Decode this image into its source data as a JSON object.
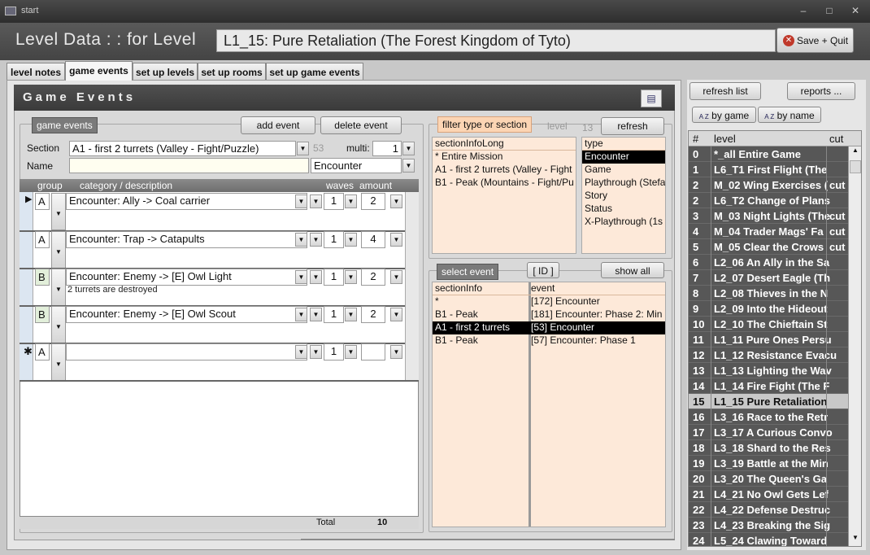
{
  "window": {
    "title": "start",
    "min": "–",
    "max": "□",
    "close": "✕"
  },
  "header": {
    "title": "Level Data : : for Level",
    "level_value": "L1_15: Pure Retaliation (The Forest Kingdom of Tyto)",
    "save_quit": "Save + Quit"
  },
  "tabs": [
    "level notes",
    "game events",
    "set up levels",
    "set up rooms",
    "set up game events"
  ],
  "panel": {
    "title": "Game Events"
  },
  "events_group": {
    "label": "game events",
    "add_event": "add event",
    "delete_event": "delete event",
    "section_label": "Section",
    "section_value": "A1 - first 2 turrets (Valley - Fight/Puzzle)",
    "section_num": "53",
    "multi_label": "multi:",
    "multi_value": "1",
    "name_label": "Name",
    "name_value": "",
    "type_value": "Encounter",
    "grid": {
      "col_group": "group",
      "col_category": "category / description",
      "col_waves": "waves",
      "col_amount": "amount",
      "rows": [
        {
          "group": "A",
          "category": "Encounter: Ally -> Coal carrier",
          "waves": "1",
          "amount": "2",
          "desc": ""
        },
        {
          "group": "A",
          "category": "Encounter: Trap -> Catapults",
          "waves": "1",
          "amount": "4",
          "desc": ""
        },
        {
          "group": "B",
          "category": "Encounter: Enemy -> [E] Owl Light",
          "waves": "1",
          "amount": "2",
          "desc": "2 turrets are destroyed"
        },
        {
          "group": "B",
          "category": "Encounter: Enemy -> [E] Owl Scout",
          "waves": "1",
          "amount": "2",
          "desc": ""
        },
        {
          "group": "A",
          "category": "",
          "waves": "1",
          "amount": "",
          "desc": ""
        }
      ],
      "new_row_marker": "✱",
      "current_row_marker": "▶",
      "total_label": "Total",
      "total_value": "10"
    }
  },
  "filter": {
    "label": "filter type or section",
    "level_label": "level",
    "level_value": "13",
    "refresh": "refresh",
    "section_header": "sectionInfoLong",
    "sections": [
      "* Entire Mission",
      "A1 - first 2 turrets (Valley - Fight",
      "B1 - Peak (Mountains - Fight/Pu"
    ],
    "type_header": "type",
    "types": [
      "Encounter",
      "Game",
      "Playthrough (Stefa",
      "Story",
      "Status",
      "X-Playthrough (1s"
    ]
  },
  "select_event": {
    "label": "select event",
    "id_button": "[ ID ]",
    "show_all": "show all",
    "col_section": "sectionInfo",
    "col_event": "event",
    "rows": [
      {
        "section": "*",
        "event": "[172] Encounter"
      },
      {
        "section": "B1 - Peak",
        "event": "[181] Encounter: Phase 2: Min"
      },
      {
        "section": "A1 - first 2 turrets",
        "event": "[53] Encounter"
      },
      {
        "section": "B1 - Peak",
        "event": "[57] Encounter: Phase 1"
      }
    ]
  },
  "right": {
    "refresh_list": "refresh list",
    "reports": "reports ...",
    "by_game": "by game",
    "by_name": "by name",
    "sort_icon_text": "A Z",
    "col_num": "#",
    "col_level": "level",
    "col_cut": "cut",
    "levels": [
      {
        "n": "0",
        "level": "*_all Entire Game",
        "cut": ""
      },
      {
        "n": "1",
        "level": "L6_T1 First Flight (The",
        "cut": ""
      },
      {
        "n": "2",
        "level": "M_02 Wing Exercises (",
        "cut": "cut"
      },
      {
        "n": "2",
        "level": "L6_T2 Change of Plans",
        "cut": ""
      },
      {
        "n": "3",
        "level": "M_03 Night Lights (The",
        "cut": "cut"
      },
      {
        "n": "4",
        "level": "M_04 Trader Mags' Fa",
        "cut": "cut"
      },
      {
        "n": "5",
        "level": "M_05 Clear the Crows",
        "cut": "cut"
      },
      {
        "n": "6",
        "level": "L2_06 An Ally in the Sa",
        "cut": ""
      },
      {
        "n": "7",
        "level": "L2_07 Desert Eagle (Th",
        "cut": ""
      },
      {
        "n": "8",
        "level": "L2_08 Thieves in the N",
        "cut": ""
      },
      {
        "n": "9",
        "level": "L2_09 Into the Hideout",
        "cut": ""
      },
      {
        "n": "10",
        "level": "L2_10 The Chieftain St",
        "cut": ""
      },
      {
        "n": "11",
        "level": "L1_11 Pure Ones Persu",
        "cut": ""
      },
      {
        "n": "12",
        "level": "L1_12 Resistance Evacu",
        "cut": ""
      },
      {
        "n": "13",
        "level": "L1_13 Lighting the Wav",
        "cut": ""
      },
      {
        "n": "14",
        "level": "L1_14 Fire Fight (The F",
        "cut": ""
      },
      {
        "n": "15",
        "level": "L1_15 Pure Retaliation",
        "cut": ""
      },
      {
        "n": "16",
        "level": "L3_16 Race to the Retr",
        "cut": ""
      },
      {
        "n": "17",
        "level": "L3_17 A Curious Convo",
        "cut": ""
      },
      {
        "n": "18",
        "level": "L3_18 Shard to the Res",
        "cut": ""
      },
      {
        "n": "19",
        "level": "L3_19 Battle at the Min",
        "cut": ""
      },
      {
        "n": "20",
        "level": "L3_20 The Queen's Ga",
        "cut": ""
      },
      {
        "n": "21",
        "level": "L4_21 No Owl Gets Lef",
        "cut": ""
      },
      {
        "n": "22",
        "level": "L4_22 Defense Destruc",
        "cut": ""
      },
      {
        "n": "23",
        "level": "L4_23 Breaking the Sig",
        "cut": ""
      },
      {
        "n": "24",
        "level": "L5_24 Clawing Toward",
        "cut": ""
      }
    ],
    "selected_level": "15"
  }
}
